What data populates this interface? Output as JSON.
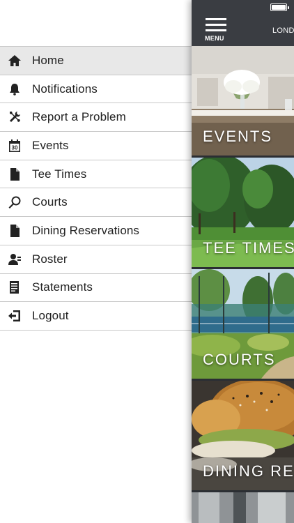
{
  "drawer": {
    "items": [
      {
        "label": "Home",
        "icon": "home-icon",
        "active": true
      },
      {
        "label": "Notifications",
        "icon": "bell-icon"
      },
      {
        "label": "Report a Problem",
        "icon": "tools-icon"
      },
      {
        "label": "Events",
        "icon": "calendar-icon",
        "calendar_day": "30"
      },
      {
        "label": "Tee Times",
        "icon": "document-icon"
      },
      {
        "label": "Courts",
        "icon": "racket-icon"
      },
      {
        "label": "Dining Reservations",
        "icon": "document-icon"
      },
      {
        "label": "Roster",
        "icon": "person-icon"
      },
      {
        "label": "Statements",
        "icon": "statement-icon"
      },
      {
        "label": "Logout",
        "icon": "logout-icon"
      }
    ]
  },
  "header": {
    "menu_caption": "MENU",
    "club_name": "LOND"
  },
  "tiles": [
    {
      "label": "EVENTS"
    },
    {
      "label": "TEE TIMES"
    },
    {
      "label": "COURTS"
    },
    {
      "label": "DINING RES"
    }
  ],
  "colors": {
    "active_item_bg": "#e8e8e8",
    "header_bg": "#3a3d42"
  }
}
